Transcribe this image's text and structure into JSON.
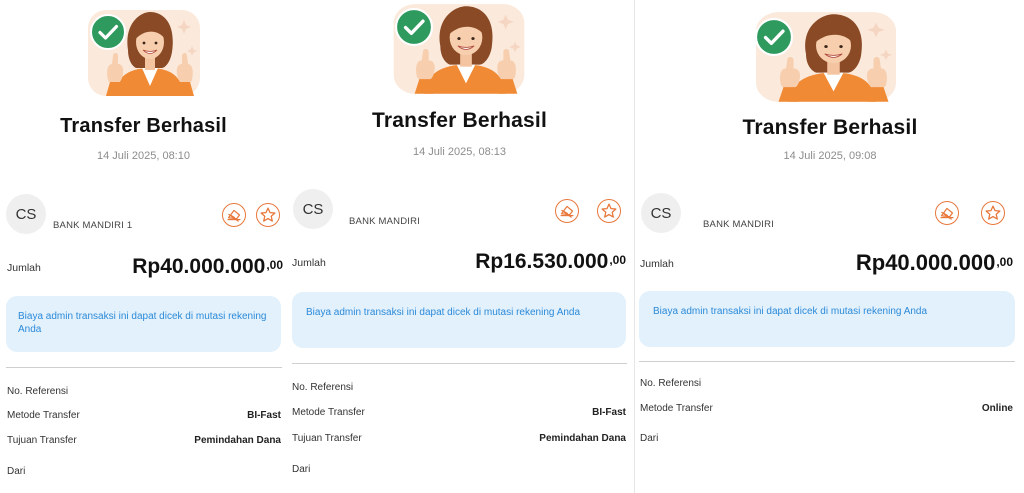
{
  "screens": [
    {
      "title": "Transfer Berhasil",
      "date": "14 Juli 2025, 08:10",
      "avatar_initials": "CS",
      "bank": "BANK MANDIRI 1",
      "amount_label": "Jumlah",
      "amount": "Rp40.000.000",
      "amount_cents": ",00",
      "info": "Biaya admin transaksi ini dapat dicek di mutasi rekening Anda",
      "reference_label": "No. Referensi",
      "method_label": "Metode Transfer",
      "method_value": "BI-Fast",
      "purpose_label": "Tujuan Transfer",
      "purpose_value": "Pemindahan Dana",
      "from_label": "Dari"
    },
    {
      "title": "Transfer Berhasil",
      "date": "14 Juli 2025, 08:13",
      "avatar_initials": "CS",
      "bank": "BANK MANDIRI",
      "amount_label": "Jumlah",
      "amount": "Rp16.530.000",
      "amount_cents": ",00",
      "info": "Biaya admin transaksi ini dapat dicek di mutasi rekening Anda",
      "reference_label": "No. Referensi",
      "method_label": "Metode Transfer",
      "method_value": "BI-Fast",
      "purpose_label": "Tujuan Transfer",
      "purpose_value": "Pemindahan Dana",
      "from_label": "Dari"
    },
    {
      "title": "Transfer Berhasil",
      "date": "14 Juli 2025, 09:08",
      "avatar_initials": "CS",
      "bank": "BANK MANDIRI",
      "amount_label": "Jumlah",
      "amount": "Rp40.000.000",
      "amount_cents": ",00",
      "info": "Biaya admin transaksi ini dapat dicek di mutasi rekening Anda",
      "reference_label": "No. Referensi",
      "method_label": "Metode Transfer",
      "method_value": "Online",
      "from_label": "Dari"
    }
  ],
  "icons": {
    "success": "check-circle-icon",
    "woman": "woman-thumbs-up-illustration",
    "receipt_action": "share-receipt-icon",
    "favorite_action": "star-icon"
  },
  "colors": {
    "success_green": "#2e9a5e",
    "accent_orange": "#e8773a",
    "info_bg": "#e3f1fc",
    "info_text": "#2b8ad8"
  }
}
